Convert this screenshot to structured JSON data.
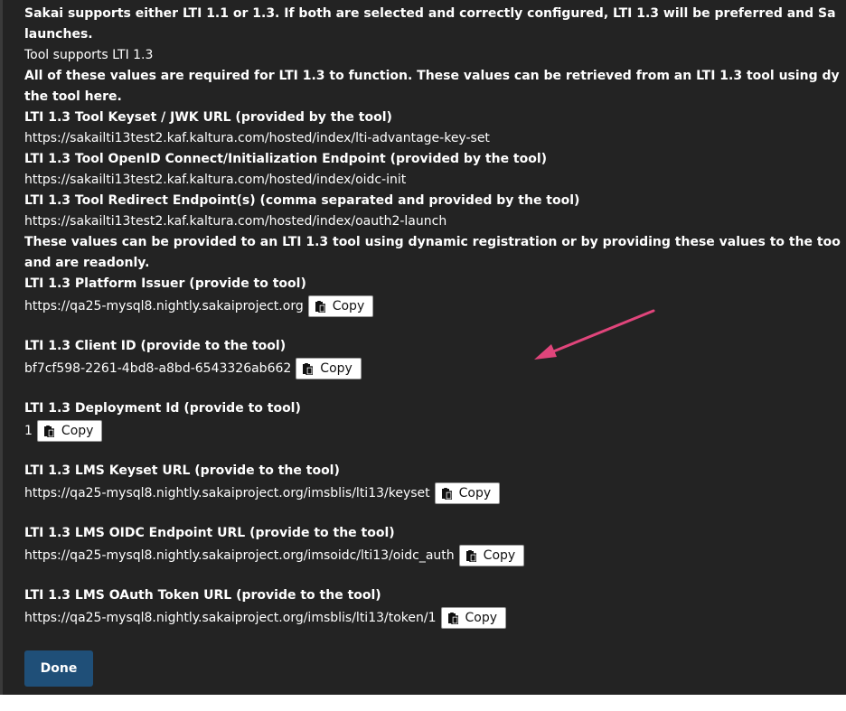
{
  "intro": {
    "line1": "Sakai supports either LTI 1.1 or 1.3. If both are selected and correctly configured, LTI 1.3 will be preferred and Sa",
    "line2": "launches.",
    "tool_supports": "Tool supports LTI 1.3",
    "required_line1": "All of these values are required for LTI 1.3 to function. These values can be retrieved from an LTI 1.3 tool using dy",
    "required_line2": "the tool here."
  },
  "tool_fields": [
    {
      "label": "LTI 1.3 Tool Keyset / JWK URL (provided by the tool)",
      "value": "https://sakailti13test2.kaf.kaltura.com/hosted/index/lti-advantage-key-set"
    },
    {
      "label": "LTI 1.3 Tool OpenID Connect/Initialization Endpoint (provided by the tool)",
      "value": "https://sakailti13test2.kaf.kaltura.com/hosted/index/oidc-init"
    },
    {
      "label": "LTI 1.3 Tool Redirect Endpoint(s) (comma separated and provided by the tool)",
      "value": "https://sakailti13test2.kaf.kaltura.com/hosted/index/oauth2-launch"
    }
  ],
  "provide_note": {
    "line1": "These values can be provided to an LTI 1.3 tool using dynamic registration or by providing these values to the too",
    "line2": "and are readonly."
  },
  "platform_fields": [
    {
      "label": "LTI 1.3 Platform Issuer (provide to tool)",
      "value": "https://qa25-mysql8.nightly.sakaiproject.org"
    },
    {
      "label": "LTI 1.3 Client ID (provide to the tool)",
      "value": "bf7cf598-2261-4bd8-a8bd-6543326ab662"
    },
    {
      "label": "LTI 1.3 Deployment Id (provide to tool)",
      "value": "1"
    },
    {
      "label": "LTI 1.3 LMS Keyset URL (provide to the tool)",
      "value": "https://qa25-mysql8.nightly.sakaiproject.org/imsblis/lti13/keyset"
    },
    {
      "label": "LTI 1.3 LMS OIDC Endpoint URL (provide to the tool)",
      "value": "https://qa25-mysql8.nightly.sakaiproject.org/imsoidc/lti13/oidc_auth"
    },
    {
      "label": "LTI 1.3 LMS OAuth Token URL (provide to the tool)",
      "value": "https://qa25-mysql8.nightly.sakaiproject.org/imsblis/lti13/token/1"
    }
  ],
  "copy_label": "Copy",
  "copy_icon": "clipboard-icon",
  "done_label": "Done",
  "colors": {
    "background": "#232323",
    "text": "#ffffff",
    "done_button": "#1f4f78",
    "annotation_arrow": "#e0457b"
  }
}
